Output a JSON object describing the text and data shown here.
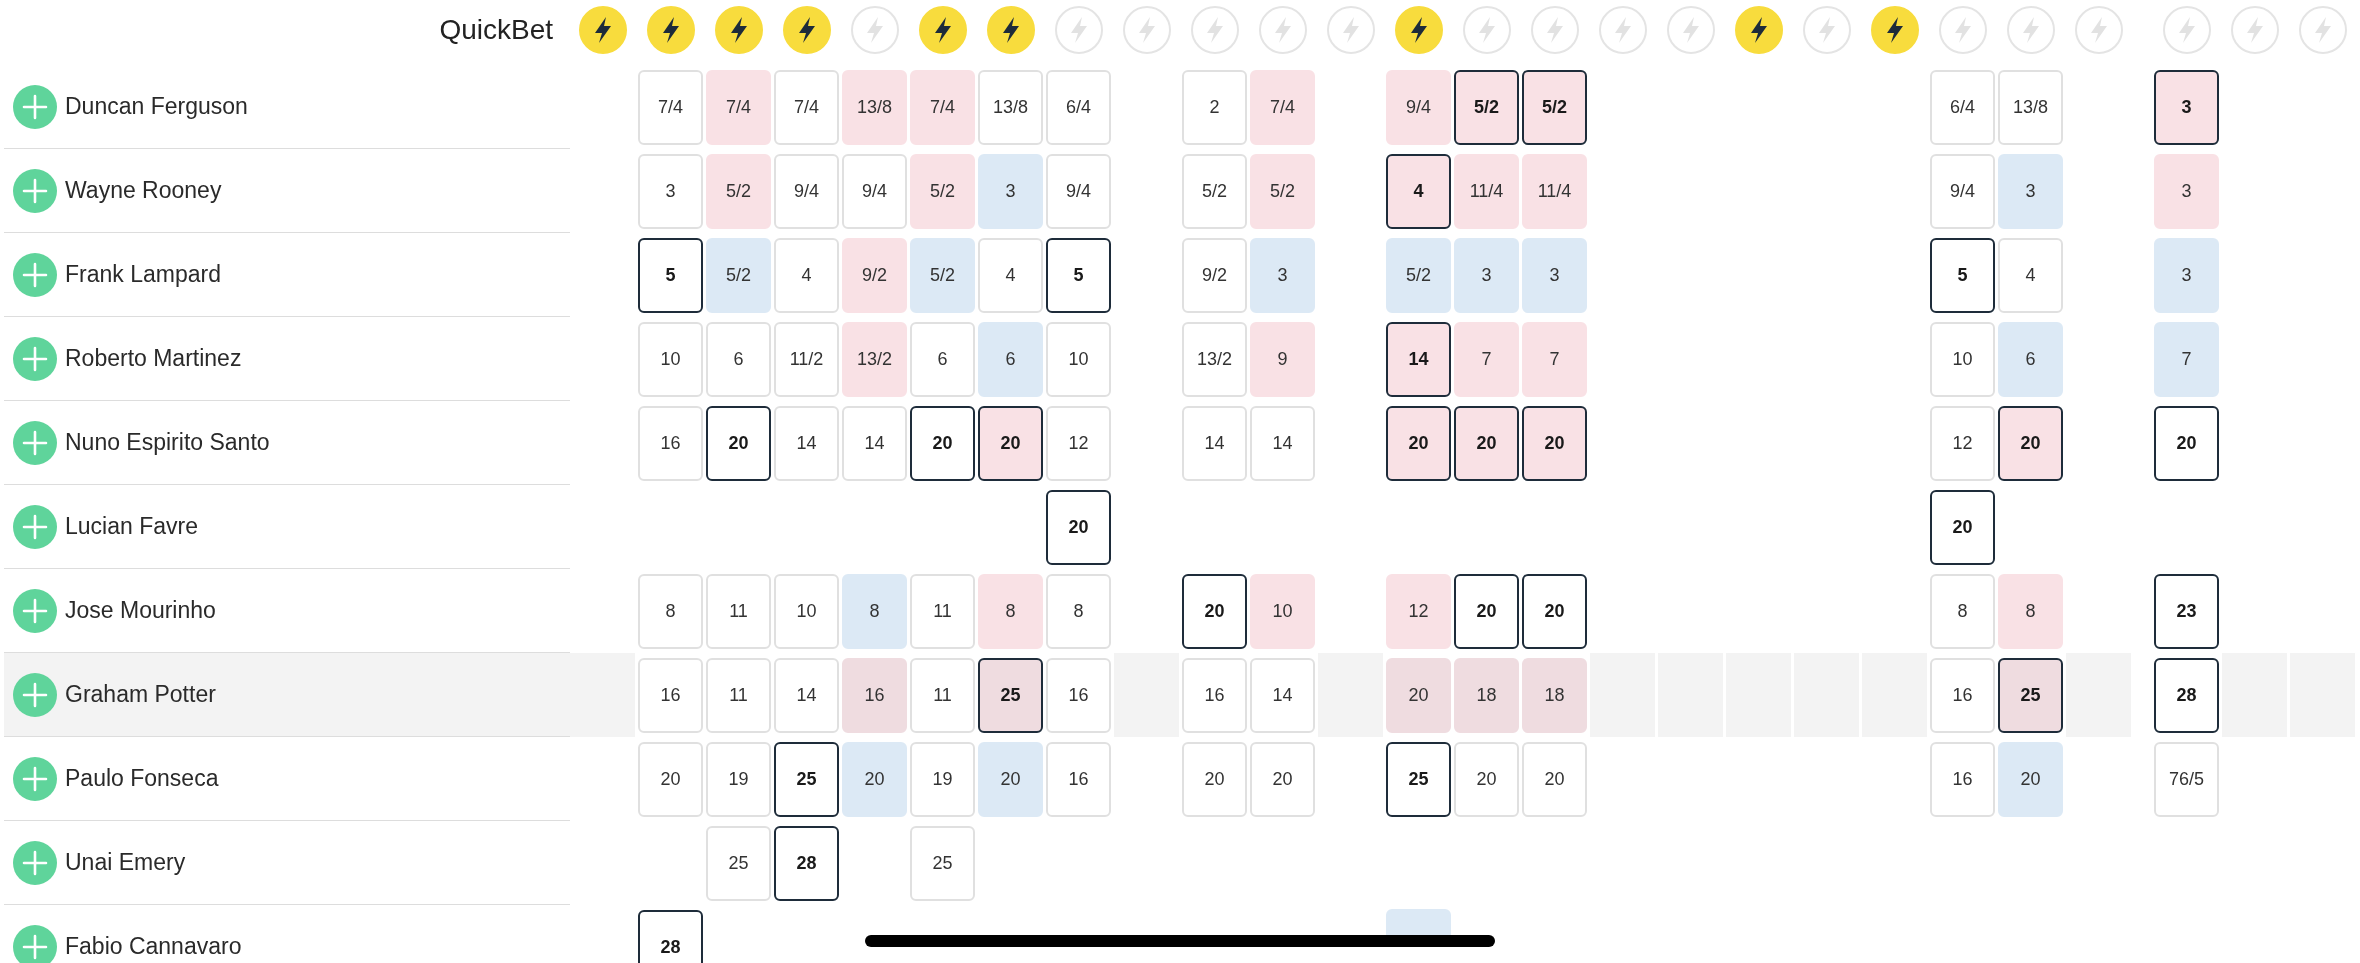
{
  "header": {
    "label": "QuickBet"
  },
  "column_groups": [
    {
      "columns": [
        {
          "enabled": true
        },
        {
          "enabled": true
        },
        {
          "enabled": true
        },
        {
          "enabled": true
        },
        {
          "enabled": false
        },
        {
          "enabled": true
        },
        {
          "enabled": true
        },
        {
          "enabled": false
        },
        {
          "enabled": false
        },
        {
          "enabled": false
        },
        {
          "enabled": false
        },
        {
          "enabled": false
        },
        {
          "enabled": true
        },
        {
          "enabled": false
        },
        {
          "enabled": false
        },
        {
          "enabled": false
        },
        {
          "enabled": false
        },
        {
          "enabled": true
        },
        {
          "enabled": false
        },
        {
          "enabled": true
        },
        {
          "enabled": false
        },
        {
          "enabled": false
        },
        {
          "enabled": false
        }
      ]
    },
    {
      "columns": [
        {
          "enabled": false
        },
        {
          "enabled": false
        },
        {
          "enabled": false
        }
      ]
    }
  ],
  "rows": [
    {
      "name": "Duncan Ferguson",
      "highlighted": false,
      "cells": [
        null,
        {
          "odds": "7/4",
          "best": false,
          "drifting": false,
          "shortening": false
        },
        {
          "odds": "7/4",
          "best": false,
          "drifting": true,
          "shortening": false
        },
        {
          "odds": "7/4",
          "best": false,
          "drifting": false,
          "shortening": false
        },
        {
          "odds": "13/8",
          "best": false,
          "drifting": true,
          "shortening": false
        },
        {
          "odds": "7/4",
          "best": false,
          "drifting": true,
          "shortening": false
        },
        {
          "odds": "13/8",
          "best": false,
          "drifting": false,
          "shortening": false
        },
        {
          "odds": "6/4",
          "best": false,
          "drifting": false,
          "shortening": false
        },
        null,
        {
          "odds": "2",
          "best": false,
          "drifting": false,
          "shortening": false
        },
        {
          "odds": "7/4",
          "best": false,
          "drifting": true,
          "shortening": false
        },
        null,
        {
          "odds": "9/4",
          "best": false,
          "drifting": true,
          "shortening": false
        },
        {
          "odds": "5/2",
          "best": true,
          "drifting": true,
          "shortening": false
        },
        {
          "odds": "5/2",
          "best": true,
          "drifting": true,
          "shortening": false
        },
        null,
        null,
        null,
        null,
        null,
        {
          "odds": "6/4",
          "best": false,
          "drifting": false,
          "shortening": false
        },
        {
          "odds": "13/8",
          "best": false,
          "drifting": false,
          "shortening": false
        },
        null,
        {
          "odds": "3",
          "best": true,
          "drifting": true,
          "shortening": false
        },
        null,
        null
      ]
    },
    {
      "name": "Wayne Rooney",
      "highlighted": false,
      "cells": [
        null,
        {
          "odds": "3",
          "best": false,
          "drifting": false,
          "shortening": false
        },
        {
          "odds": "5/2",
          "best": false,
          "drifting": true,
          "shortening": false
        },
        {
          "odds": "9/4",
          "best": false,
          "drifting": false,
          "shortening": false
        },
        {
          "odds": "9/4",
          "best": false,
          "drifting": false,
          "shortening": false
        },
        {
          "odds": "5/2",
          "best": false,
          "drifting": true,
          "shortening": false
        },
        {
          "odds": "3",
          "best": false,
          "drifting": false,
          "shortening": true
        },
        {
          "odds": "9/4",
          "best": false,
          "drifting": false,
          "shortening": false
        },
        null,
        {
          "odds": "5/2",
          "best": false,
          "drifting": false,
          "shortening": false
        },
        {
          "odds": "5/2",
          "best": false,
          "drifting": true,
          "shortening": false
        },
        null,
        {
          "odds": "4",
          "best": true,
          "drifting": true,
          "shortening": false
        },
        {
          "odds": "11/4",
          "best": false,
          "drifting": true,
          "shortening": false
        },
        {
          "odds": "11/4",
          "best": false,
          "drifting": true,
          "shortening": false
        },
        null,
        null,
        null,
        null,
        null,
        {
          "odds": "9/4",
          "best": false,
          "drifting": false,
          "shortening": false
        },
        {
          "odds": "3",
          "best": false,
          "drifting": false,
          "shortening": true
        },
        null,
        {
          "odds": "3",
          "best": false,
          "drifting": true,
          "shortening": false
        },
        null,
        null
      ]
    },
    {
      "name": "Frank Lampard",
      "highlighted": false,
      "cells": [
        null,
        {
          "odds": "5",
          "best": true,
          "drifting": false,
          "shortening": false
        },
        {
          "odds": "5/2",
          "best": false,
          "drifting": false,
          "shortening": true
        },
        {
          "odds": "4",
          "best": false,
          "drifting": false,
          "shortening": false
        },
        {
          "odds": "9/2",
          "best": false,
          "drifting": true,
          "shortening": false
        },
        {
          "odds": "5/2",
          "best": false,
          "drifting": false,
          "shortening": true
        },
        {
          "odds": "4",
          "best": false,
          "drifting": false,
          "shortening": false
        },
        {
          "odds": "5",
          "best": true,
          "drifting": false,
          "shortening": false
        },
        null,
        {
          "odds": "9/2",
          "best": false,
          "drifting": false,
          "shortening": false
        },
        {
          "odds": "3",
          "best": false,
          "drifting": false,
          "shortening": true
        },
        null,
        {
          "odds": "5/2",
          "best": false,
          "drifting": false,
          "shortening": true
        },
        {
          "odds": "3",
          "best": false,
          "drifting": false,
          "shortening": true
        },
        {
          "odds": "3",
          "best": false,
          "drifting": false,
          "shortening": true
        },
        null,
        null,
        null,
        null,
        null,
        {
          "odds": "5",
          "best": true,
          "drifting": false,
          "shortening": false
        },
        {
          "odds": "4",
          "best": false,
          "drifting": false,
          "shortening": false
        },
        null,
        {
          "odds": "3",
          "best": false,
          "drifting": false,
          "shortening": true
        },
        null,
        null
      ]
    },
    {
      "name": "Roberto Martinez",
      "highlighted": false,
      "cells": [
        null,
        {
          "odds": "10",
          "best": false,
          "drifting": false,
          "shortening": false
        },
        {
          "odds": "6",
          "best": false,
          "drifting": false,
          "shortening": false
        },
        {
          "odds": "11/2",
          "best": false,
          "drifting": false,
          "shortening": false
        },
        {
          "odds": "13/2",
          "best": false,
          "drifting": true,
          "shortening": false
        },
        {
          "odds": "6",
          "best": false,
          "drifting": false,
          "shortening": false
        },
        {
          "odds": "6",
          "best": false,
          "drifting": false,
          "shortening": true
        },
        {
          "odds": "10",
          "best": false,
          "drifting": false,
          "shortening": false
        },
        null,
        {
          "odds": "13/2",
          "best": false,
          "drifting": false,
          "shortening": false
        },
        {
          "odds": "9",
          "best": false,
          "drifting": true,
          "shortening": false
        },
        null,
        {
          "odds": "14",
          "best": true,
          "drifting": true,
          "shortening": false
        },
        {
          "odds": "7",
          "best": false,
          "drifting": true,
          "shortening": false
        },
        {
          "odds": "7",
          "best": false,
          "drifting": true,
          "shortening": false
        },
        null,
        null,
        null,
        null,
        null,
        {
          "odds": "10",
          "best": false,
          "drifting": false,
          "shortening": false
        },
        {
          "odds": "6",
          "best": false,
          "drifting": false,
          "shortening": true
        },
        null,
        {
          "odds": "7",
          "best": false,
          "drifting": false,
          "shortening": true
        },
        null,
        null
      ]
    },
    {
      "name": "Nuno Espirito Santo",
      "highlighted": false,
      "cells": [
        null,
        {
          "odds": "16",
          "best": false,
          "drifting": false,
          "shortening": false
        },
        {
          "odds": "20",
          "best": true,
          "drifting": false,
          "shortening": false
        },
        {
          "odds": "14",
          "best": false,
          "drifting": false,
          "shortening": false
        },
        {
          "odds": "14",
          "best": false,
          "drifting": false,
          "shortening": false
        },
        {
          "odds": "20",
          "best": true,
          "drifting": false,
          "shortening": false
        },
        {
          "odds": "20",
          "best": true,
          "drifting": true,
          "shortening": false
        },
        {
          "odds": "12",
          "best": false,
          "drifting": false,
          "shortening": false
        },
        null,
        {
          "odds": "14",
          "best": false,
          "drifting": false,
          "shortening": false
        },
        {
          "odds": "14",
          "best": false,
          "drifting": false,
          "shortening": false
        },
        null,
        {
          "odds": "20",
          "best": true,
          "drifting": true,
          "shortening": false
        },
        {
          "odds": "20",
          "best": true,
          "drifting": true,
          "shortening": false
        },
        {
          "odds": "20",
          "best": true,
          "drifting": true,
          "shortening": false
        },
        null,
        null,
        null,
        null,
        null,
        {
          "odds": "12",
          "best": false,
          "drifting": false,
          "shortening": false
        },
        {
          "odds": "20",
          "best": true,
          "drifting": true,
          "shortening": false
        },
        null,
        {
          "odds": "20",
          "best": true,
          "drifting": false,
          "shortening": false
        },
        null,
        null
      ]
    },
    {
      "name": "Lucian Favre",
      "highlighted": false,
      "cells": [
        null,
        null,
        null,
        null,
        null,
        null,
        null,
        {
          "odds": "20",
          "best": true,
          "drifting": false,
          "shortening": false
        },
        null,
        null,
        null,
        null,
        null,
        null,
        null,
        null,
        null,
        null,
        null,
        null,
        {
          "odds": "20",
          "best": true,
          "drifting": false,
          "shortening": false
        },
        null,
        null,
        null,
        null,
        null
      ]
    },
    {
      "name": "Jose Mourinho",
      "highlighted": false,
      "cells": [
        null,
        {
          "odds": "8",
          "best": false,
          "drifting": false,
          "shortening": false
        },
        {
          "odds": "11",
          "best": false,
          "drifting": false,
          "shortening": false
        },
        {
          "odds": "10",
          "best": false,
          "drifting": false,
          "shortening": false
        },
        {
          "odds": "8",
          "best": false,
          "drifting": false,
          "shortening": true
        },
        {
          "odds": "11",
          "best": false,
          "drifting": false,
          "shortening": false
        },
        {
          "odds": "8",
          "best": false,
          "drifting": true,
          "shortening": false
        },
        {
          "odds": "8",
          "best": false,
          "drifting": false,
          "shortening": false
        },
        null,
        {
          "odds": "20",
          "best": true,
          "drifting": false,
          "shortening": false
        },
        {
          "odds": "10",
          "best": false,
          "drifting": true,
          "shortening": false
        },
        null,
        {
          "odds": "12",
          "best": false,
          "drifting": true,
          "shortening": false
        },
        {
          "odds": "20",
          "best": true,
          "drifting": false,
          "shortening": false
        },
        {
          "odds": "20",
          "best": true,
          "drifting": false,
          "shortening": false
        },
        null,
        null,
        null,
        null,
        null,
        {
          "odds": "8",
          "best": false,
          "drifting": false,
          "shortening": false
        },
        {
          "odds": "8",
          "best": false,
          "drifting": true,
          "shortening": false
        },
        null,
        {
          "odds": "23",
          "best": true,
          "drifting": false,
          "shortening": false
        },
        null,
        null
      ]
    },
    {
      "name": "Graham Potter",
      "highlighted": true,
      "cells": [
        null,
        {
          "odds": "16",
          "best": false,
          "drifting": false,
          "shortening": false
        },
        {
          "odds": "11",
          "best": false,
          "drifting": false,
          "shortening": false
        },
        {
          "odds": "14",
          "best": false,
          "drifting": false,
          "shortening": false
        },
        {
          "odds": "16",
          "best": false,
          "drifting": true,
          "shortening": false
        },
        {
          "odds": "11",
          "best": false,
          "drifting": false,
          "shortening": false
        },
        {
          "odds": "25",
          "best": true,
          "drifting": true,
          "shortening": false
        },
        {
          "odds": "16",
          "best": false,
          "drifting": false,
          "shortening": false
        },
        null,
        {
          "odds": "16",
          "best": false,
          "drifting": false,
          "shortening": false
        },
        {
          "odds": "14",
          "best": false,
          "drifting": false,
          "shortening": false
        },
        null,
        {
          "odds": "20",
          "best": false,
          "drifting": true,
          "shortening": false
        },
        {
          "odds": "18",
          "best": false,
          "drifting": true,
          "shortening": false
        },
        {
          "odds": "18",
          "best": false,
          "drifting": true,
          "shortening": false
        },
        null,
        null,
        null,
        null,
        null,
        {
          "odds": "16",
          "best": false,
          "drifting": false,
          "shortening": false
        },
        {
          "odds": "25",
          "best": true,
          "drifting": true,
          "shortening": false
        },
        null,
        {
          "odds": "28",
          "best": true,
          "drifting": false,
          "shortening": false
        },
        null,
        null
      ]
    },
    {
      "name": "Paulo Fonseca",
      "highlighted": false,
      "cells": [
        null,
        {
          "odds": "20",
          "best": false,
          "drifting": false,
          "shortening": false
        },
        {
          "odds": "19",
          "best": false,
          "drifting": false,
          "shortening": false
        },
        {
          "odds": "25",
          "best": true,
          "drifting": false,
          "shortening": false
        },
        {
          "odds": "20",
          "best": false,
          "drifting": false,
          "shortening": true
        },
        {
          "odds": "19",
          "best": false,
          "drifting": false,
          "shortening": false
        },
        {
          "odds": "20",
          "best": false,
          "drifting": false,
          "shortening": true
        },
        {
          "odds": "16",
          "best": false,
          "drifting": false,
          "shortening": false
        },
        null,
        {
          "odds": "20",
          "best": false,
          "drifting": false,
          "shortening": false
        },
        {
          "odds": "20",
          "best": false,
          "drifting": false,
          "shortening": false
        },
        null,
        {
          "odds": "25",
          "best": true,
          "drifting": false,
          "shortening": false
        },
        {
          "odds": "20",
          "best": false,
          "drifting": false,
          "shortening": false
        },
        {
          "odds": "20",
          "best": false,
          "drifting": false,
          "shortening": false
        },
        null,
        null,
        null,
        null,
        null,
        {
          "odds": "16",
          "best": false,
          "drifting": false,
          "shortening": false
        },
        {
          "odds": "20",
          "best": false,
          "drifting": false,
          "shortening": true
        },
        null,
        {
          "odds": "76/5",
          "best": false,
          "drifting": false,
          "shortening": false
        },
        null,
        null
      ]
    },
    {
      "name": "Unai Emery",
      "highlighted": false,
      "cells": [
        null,
        null,
        {
          "odds": "25",
          "best": false,
          "drifting": false,
          "shortening": false
        },
        {
          "odds": "28",
          "best": true,
          "drifting": false,
          "shortening": false
        },
        null,
        {
          "odds": "25",
          "best": false,
          "drifting": false,
          "shortening": false
        },
        null,
        null,
        null,
        null,
        null,
        null,
        null,
        null,
        null,
        null,
        null,
        null,
        null,
        null,
        null,
        null,
        null,
        null,
        null,
        null
      ]
    },
    {
      "name": "Fabio Cannavaro",
      "highlighted": false,
      "cells": [
        null,
        {
          "odds": "28",
          "best": true,
          "drifting": false,
          "shortening": false
        },
        null,
        null,
        null,
        null,
        null,
        null,
        null,
        null,
        null,
        null,
        {
          "best": false,
          "drifting": false,
          "shortening": true
        },
        null,
        null,
        null,
        null,
        null,
        null,
        null,
        null,
        null,
        null,
        null,
        null,
        null
      ]
    }
  ]
}
